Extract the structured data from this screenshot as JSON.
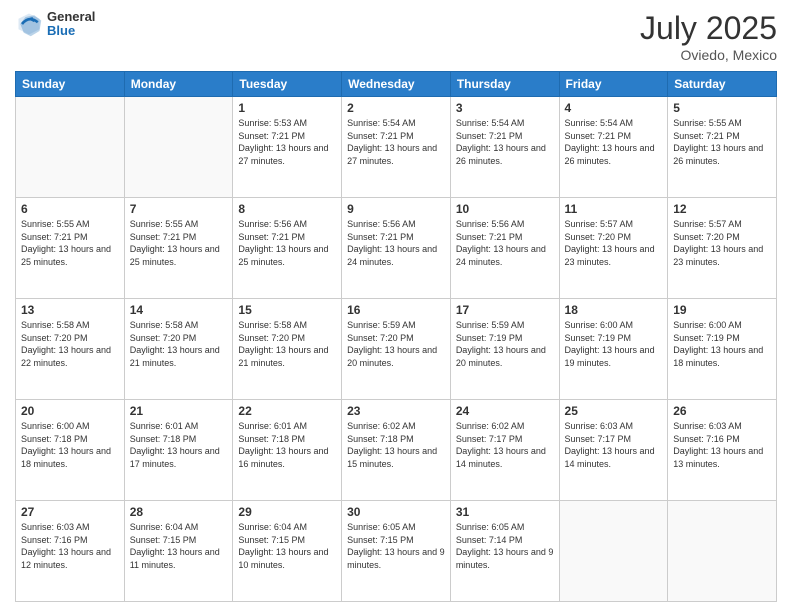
{
  "header": {
    "logo_general": "General",
    "logo_blue": "Blue",
    "month_title": "July 2025",
    "location": "Oviedo, Mexico"
  },
  "days_of_week": [
    "Sunday",
    "Monday",
    "Tuesday",
    "Wednesday",
    "Thursday",
    "Friday",
    "Saturday"
  ],
  "weeks": [
    [
      {
        "day": "",
        "text": ""
      },
      {
        "day": "",
        "text": ""
      },
      {
        "day": "1",
        "text": "Sunrise: 5:53 AM\nSunset: 7:21 PM\nDaylight: 13 hours and 27 minutes."
      },
      {
        "day": "2",
        "text": "Sunrise: 5:54 AM\nSunset: 7:21 PM\nDaylight: 13 hours and 27 minutes."
      },
      {
        "day": "3",
        "text": "Sunrise: 5:54 AM\nSunset: 7:21 PM\nDaylight: 13 hours and 26 minutes."
      },
      {
        "day": "4",
        "text": "Sunrise: 5:54 AM\nSunset: 7:21 PM\nDaylight: 13 hours and 26 minutes."
      },
      {
        "day": "5",
        "text": "Sunrise: 5:55 AM\nSunset: 7:21 PM\nDaylight: 13 hours and 26 minutes."
      }
    ],
    [
      {
        "day": "6",
        "text": "Sunrise: 5:55 AM\nSunset: 7:21 PM\nDaylight: 13 hours and 25 minutes."
      },
      {
        "day": "7",
        "text": "Sunrise: 5:55 AM\nSunset: 7:21 PM\nDaylight: 13 hours and 25 minutes."
      },
      {
        "day": "8",
        "text": "Sunrise: 5:56 AM\nSunset: 7:21 PM\nDaylight: 13 hours and 25 minutes."
      },
      {
        "day": "9",
        "text": "Sunrise: 5:56 AM\nSunset: 7:21 PM\nDaylight: 13 hours and 24 minutes."
      },
      {
        "day": "10",
        "text": "Sunrise: 5:56 AM\nSunset: 7:21 PM\nDaylight: 13 hours and 24 minutes."
      },
      {
        "day": "11",
        "text": "Sunrise: 5:57 AM\nSunset: 7:20 PM\nDaylight: 13 hours and 23 minutes."
      },
      {
        "day": "12",
        "text": "Sunrise: 5:57 AM\nSunset: 7:20 PM\nDaylight: 13 hours and 23 minutes."
      }
    ],
    [
      {
        "day": "13",
        "text": "Sunrise: 5:58 AM\nSunset: 7:20 PM\nDaylight: 13 hours and 22 minutes."
      },
      {
        "day": "14",
        "text": "Sunrise: 5:58 AM\nSunset: 7:20 PM\nDaylight: 13 hours and 21 minutes."
      },
      {
        "day": "15",
        "text": "Sunrise: 5:58 AM\nSunset: 7:20 PM\nDaylight: 13 hours and 21 minutes."
      },
      {
        "day": "16",
        "text": "Sunrise: 5:59 AM\nSunset: 7:20 PM\nDaylight: 13 hours and 20 minutes."
      },
      {
        "day": "17",
        "text": "Sunrise: 5:59 AM\nSunset: 7:19 PM\nDaylight: 13 hours and 20 minutes."
      },
      {
        "day": "18",
        "text": "Sunrise: 6:00 AM\nSunset: 7:19 PM\nDaylight: 13 hours and 19 minutes."
      },
      {
        "day": "19",
        "text": "Sunrise: 6:00 AM\nSunset: 7:19 PM\nDaylight: 13 hours and 18 minutes."
      }
    ],
    [
      {
        "day": "20",
        "text": "Sunrise: 6:00 AM\nSunset: 7:18 PM\nDaylight: 13 hours and 18 minutes."
      },
      {
        "day": "21",
        "text": "Sunrise: 6:01 AM\nSunset: 7:18 PM\nDaylight: 13 hours and 17 minutes."
      },
      {
        "day": "22",
        "text": "Sunrise: 6:01 AM\nSunset: 7:18 PM\nDaylight: 13 hours and 16 minutes."
      },
      {
        "day": "23",
        "text": "Sunrise: 6:02 AM\nSunset: 7:18 PM\nDaylight: 13 hours and 15 minutes."
      },
      {
        "day": "24",
        "text": "Sunrise: 6:02 AM\nSunset: 7:17 PM\nDaylight: 13 hours and 14 minutes."
      },
      {
        "day": "25",
        "text": "Sunrise: 6:03 AM\nSunset: 7:17 PM\nDaylight: 13 hours and 14 minutes."
      },
      {
        "day": "26",
        "text": "Sunrise: 6:03 AM\nSunset: 7:16 PM\nDaylight: 13 hours and 13 minutes."
      }
    ],
    [
      {
        "day": "27",
        "text": "Sunrise: 6:03 AM\nSunset: 7:16 PM\nDaylight: 13 hours and 12 minutes."
      },
      {
        "day": "28",
        "text": "Sunrise: 6:04 AM\nSunset: 7:15 PM\nDaylight: 13 hours and 11 minutes."
      },
      {
        "day": "29",
        "text": "Sunrise: 6:04 AM\nSunset: 7:15 PM\nDaylight: 13 hours and 10 minutes."
      },
      {
        "day": "30",
        "text": "Sunrise: 6:05 AM\nSunset: 7:15 PM\nDaylight: 13 hours and 9 minutes."
      },
      {
        "day": "31",
        "text": "Sunrise: 6:05 AM\nSunset: 7:14 PM\nDaylight: 13 hours and 9 minutes."
      },
      {
        "day": "",
        "text": ""
      },
      {
        "day": "",
        "text": ""
      }
    ]
  ]
}
